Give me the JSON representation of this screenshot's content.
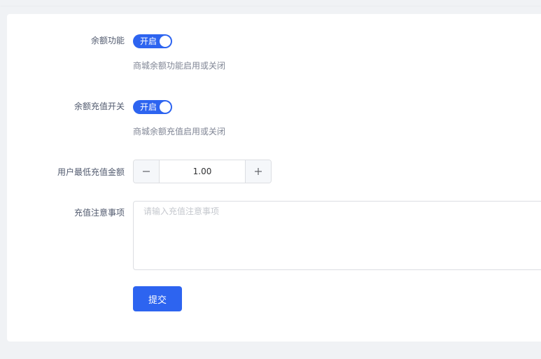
{
  "colors": {
    "accent": "#2d64f0"
  },
  "form": {
    "balance_feature": {
      "label": "余额功能",
      "switch_text": "开启",
      "enabled": true,
      "help": "商城余额功能启用或关闭"
    },
    "balance_recharge": {
      "label": "余额充值开关",
      "switch_text": "开启",
      "enabled": true,
      "help": "商城余额充值启用或关闭"
    },
    "min_recharge": {
      "label": "用户最低充值金额",
      "value": "1.00",
      "minus_icon": "minus-icon",
      "plus_icon": "plus-icon"
    },
    "recharge_notes": {
      "label": "充值注意事项",
      "placeholder": "请输入充值注意事项",
      "value": ""
    },
    "submit_label": "提交"
  }
}
